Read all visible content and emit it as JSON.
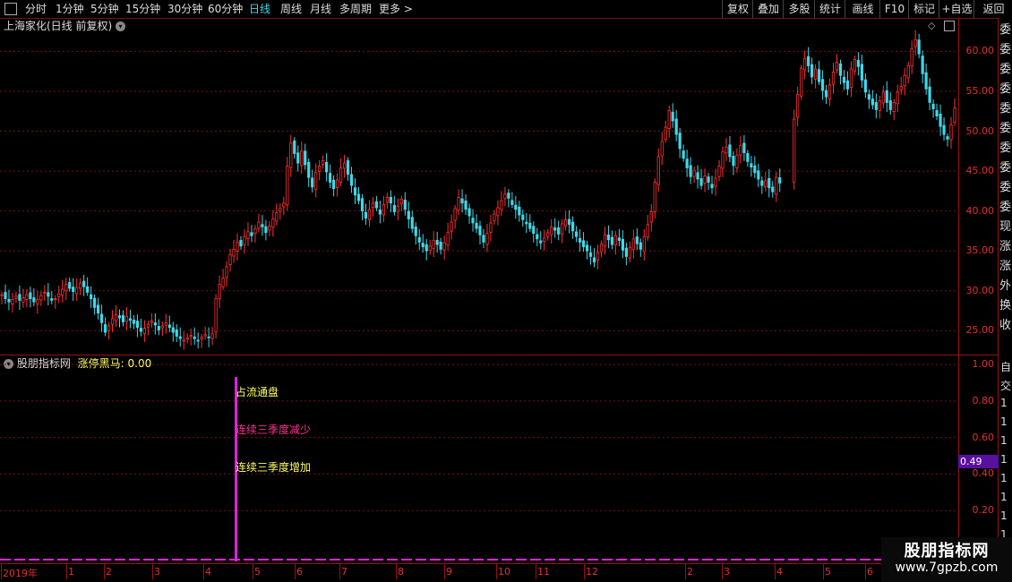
{
  "toolbar": {
    "periods": [
      "分时",
      "1分钟",
      "5分钟",
      "15分钟",
      "30分钟",
      "60分钟",
      "日线",
      "周线",
      "月线",
      "多周期",
      "更多 >"
    ],
    "active_period": "日线",
    "right_buttons": [
      "复权",
      "叠加",
      "多股",
      "统计",
      "画线",
      "F10",
      "标记",
      "+自选",
      "返回"
    ]
  },
  "main_chart": {
    "title": "上海家化(日线 前复权)",
    "y_ticks": [
      "60.00",
      "55.00",
      "50.00",
      "45.00",
      "40.00",
      "35.00",
      "30.00",
      "25.00"
    ]
  },
  "indicator": {
    "title": "股朋指标网",
    "value_label": "涨停黑马: 0.00",
    "notes": [
      "占流通盘",
      "连续三季度减少",
      "连续三季度增加"
    ],
    "y_ticks": [
      "1.00",
      "0.80",
      "0.60",
      "0.40",
      "0.20"
    ],
    "current_value": "0.49"
  },
  "x_axis_labels": [
    "2019年",
    "1",
    "2",
    "3",
    "4",
    "5",
    "6",
    "7",
    "8",
    "9",
    "10",
    "11",
    "12",
    "2",
    "3",
    "4",
    "5",
    "6"
  ],
  "right_strip_chars": [
    "委",
    "委",
    "委",
    "委",
    "委",
    "委",
    "委",
    "委",
    "委",
    "委",
    "现",
    "涨",
    "涨",
    "外",
    "换",
    "收"
  ],
  "right_strip_sub": [
    "自",
    "交",
    "1",
    "1",
    "1",
    "1",
    "1",
    "1",
    "1",
    "1",
    "1"
  ],
  "watermark": {
    "line1": "股朋指标网",
    "line2": "www.7gpzb.com"
  },
  "colors": {
    "up": "#ff3030",
    "down": "#3fd8e8",
    "grid": "#7a1010",
    "accent": "#e020e0",
    "note_yellow": "#ffff60",
    "note_pink": "#ff3090",
    "value_box": "#5a0fa0"
  },
  "chart_data": {
    "type": "candlestick",
    "title": "上海家化(日线 前复权)",
    "ylim": [
      22,
      63
    ],
    "closes": [
      29.5,
      29.0,
      28.6,
      28.9,
      29.3,
      28.8,
      29.1,
      29.5,
      29.0,
      28.6,
      28.9,
      29.4,
      29.8,
      29.3,
      28.8,
      29.0,
      29.6,
      30.2,
      30.8,
      30.3,
      29.9,
      30.4,
      30.9,
      30.5,
      29.8,
      29.0,
      27.9,
      27.2,
      26.0,
      24.8,
      25.6,
      26.5,
      27.0,
      26.6,
      26.1,
      26.8,
      26.3,
      25.9,
      25.4,
      24.9,
      25.3,
      25.8,
      26.2,
      25.7,
      25.1,
      25.6,
      26.0,
      25.4,
      24.8,
      24.3,
      24.0,
      23.8,
      24.1,
      24.4,
      24.0,
      23.7,
      24.2,
      24.5,
      24.1,
      24.6,
      29.0,
      30.8,
      31.6,
      33.0,
      34.5,
      35.2,
      36.1,
      35.6,
      36.8,
      37.4,
      36.9,
      37.8,
      38.6,
      38.0,
      37.3,
      38.1,
      39.0,
      39.8,
      40.3,
      41.0,
      45.6,
      48.5,
      47.2,
      46.0,
      47.5,
      45.8,
      44.2,
      43.0,
      44.8,
      45.6,
      46.3,
      44.9,
      43.6,
      42.8,
      43.9,
      45.4,
      46.0,
      44.6,
      43.2,
      42.0,
      41.3,
      40.0,
      39.1,
      40.2,
      41.0,
      40.4,
      39.6,
      40.8,
      41.7,
      41.0,
      39.9,
      40.6,
      41.5,
      40.2,
      39.0,
      37.8,
      36.9,
      36.1,
      35.5,
      35.0,
      35.6,
      36.3,
      35.8,
      35.2,
      36.0,
      37.3,
      38.6,
      40.3,
      41.7,
      41.0,
      40.2,
      39.4,
      38.5,
      37.8,
      37.0,
      36.1,
      37.2,
      38.5,
      39.6,
      40.4,
      41.3,
      42.1,
      41.6,
      40.8,
      40.2,
      39.5,
      38.9,
      38.4,
      37.8,
      37.2,
      36.5,
      36.0,
      36.6,
      37.3,
      38.0,
      37.6,
      37.1,
      38.4,
      38.9,
      38.3,
      37.5,
      36.8,
      36.1,
      35.5,
      35.0,
      34.3,
      33.6,
      34.8,
      35.9,
      37.0,
      36.4,
      35.8,
      36.9,
      36.3,
      35.1,
      34.3,
      35.4,
      36.5,
      35.9,
      35.2,
      36.8,
      38.3,
      39.9,
      43.6,
      46.8,
      48.7,
      50.5,
      52.6,
      51.3,
      49.6,
      47.8,
      46.6,
      45.4,
      44.3,
      45.1,
      44.0,
      43.2,
      44.4,
      43.6,
      42.9,
      44.1,
      45.6,
      47.4,
      48.0,
      46.8,
      45.7,
      47.0,
      48.2,
      47.3,
      46.2,
      45.5,
      44.8,
      44.0,
      43.2,
      43.8,
      42.9,
      42.4,
      44.2,
      43.5,
      null,
      null,
      null,
      51.5,
      54.6,
      57.9,
      59.1,
      58.2,
      56.8,
      57.8,
      56.2,
      55.1,
      54.3,
      55.8,
      57.4,
      58.6,
      57.0,
      56.1,
      55.3,
      57.8,
      59.0,
      58.1,
      56.4,
      54.9,
      54.0,
      53.3,
      52.7,
      53.8,
      54.9,
      53.6,
      52.7,
      53.6,
      54.9,
      55.6,
      57.0,
      58.2,
      60.3,
      61.5,
      59.7,
      57.2,
      55.3,
      53.6,
      52.8,
      51.9,
      50.6,
      49.6,
      49.0,
      50.8,
      52.9
    ]
  }
}
